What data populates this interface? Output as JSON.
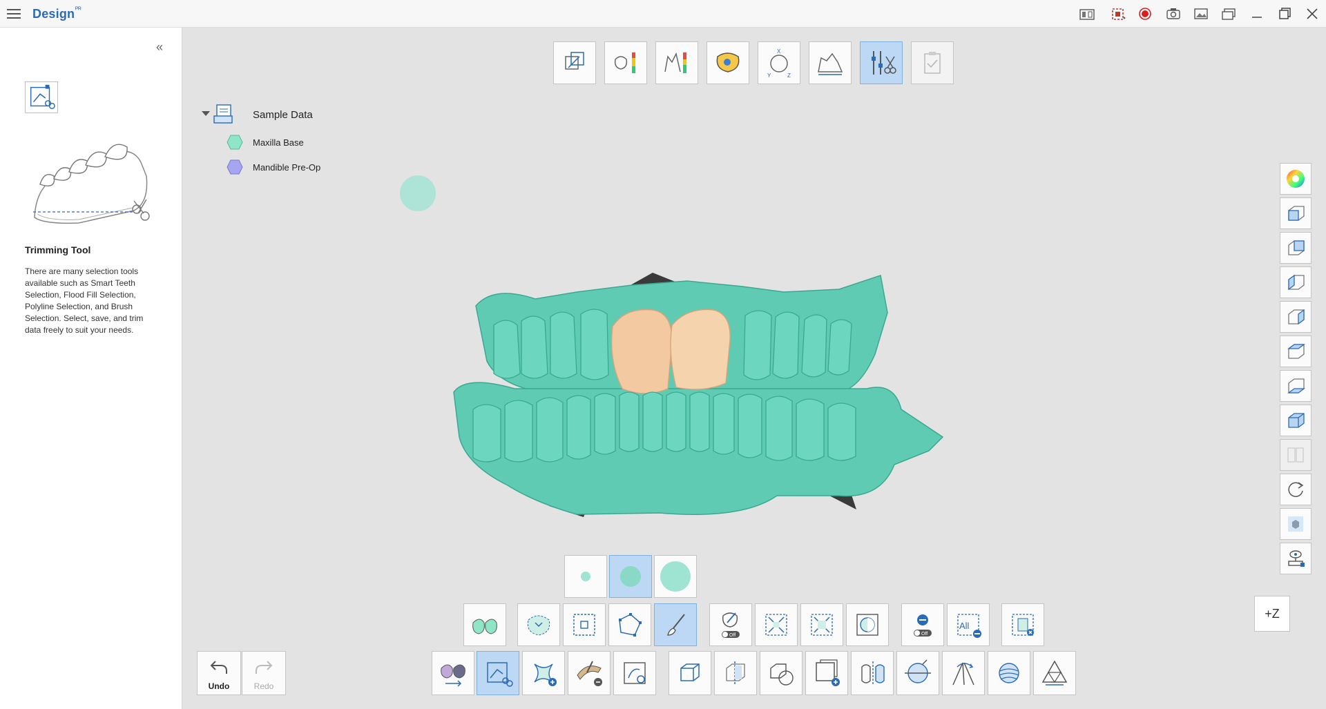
{
  "titlebar": {
    "app_title": "Design",
    "app_badge": "ᴾᴿ",
    "buttons": [
      {
        "name": "compare-view-icon",
        "label": ""
      },
      {
        "name": "screen-capture-icon",
        "label": ""
      },
      {
        "name": "record-icon",
        "label": ""
      },
      {
        "name": "camera-icon",
        "label": ""
      },
      {
        "name": "image-gallery-icon",
        "label": ""
      },
      {
        "name": "window-switch-icon",
        "label": ""
      },
      {
        "name": "minimize-icon",
        "label": ""
      },
      {
        "name": "restore-icon",
        "label": ""
      },
      {
        "name": "close-icon",
        "label": ""
      }
    ]
  },
  "sidebar": {
    "collapse_label": "«",
    "tool_title": "Trimming Tool",
    "tool_description": "There are many selection tools available such as Smart Teeth Selection, Flood Fill Selection, Polyline Selection, and Brush Selection. Select, save, and trim data freely to suit your needs."
  },
  "tree": {
    "root_label": "Sample Data",
    "items": [
      {
        "label": "Maxilla Base",
        "color": "#8ee6c6"
      },
      {
        "label": "Mandible Pre-Op",
        "color": "#a8a5f0"
      }
    ]
  },
  "undo_redo": {
    "undo_label": "Undo",
    "redo_label": "Redo"
  },
  "view": {
    "z_axis_label": "+Z"
  },
  "colors": {
    "accent": "#2a6bb5",
    "active_tool_bg": "#bcd8f5",
    "model_green": "#5fcbb3",
    "crown": "#f2c9a0"
  }
}
